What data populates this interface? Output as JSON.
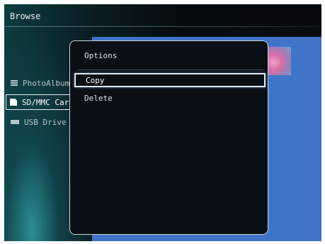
{
  "header": {
    "title": "Browse"
  },
  "sidebar": {
    "items": [
      {
        "label": "PhotoAlbum",
        "icon": "list-icon",
        "active": false
      },
      {
        "label": "SD/MMC Card",
        "icon": "memory-card-icon",
        "active": true
      },
      {
        "label": "USB Drive",
        "icon": "usb-drive-icon",
        "active": false
      }
    ]
  },
  "dialog": {
    "title": "Options",
    "options": [
      {
        "label": "Copy",
        "selected": true
      },
      {
        "label": "Delete",
        "selected": false
      }
    ]
  },
  "colors": {
    "photo_pane": "#3f74c9",
    "dialog_bg": "#0a0f15",
    "accent_border": "#dfe8ea"
  }
}
